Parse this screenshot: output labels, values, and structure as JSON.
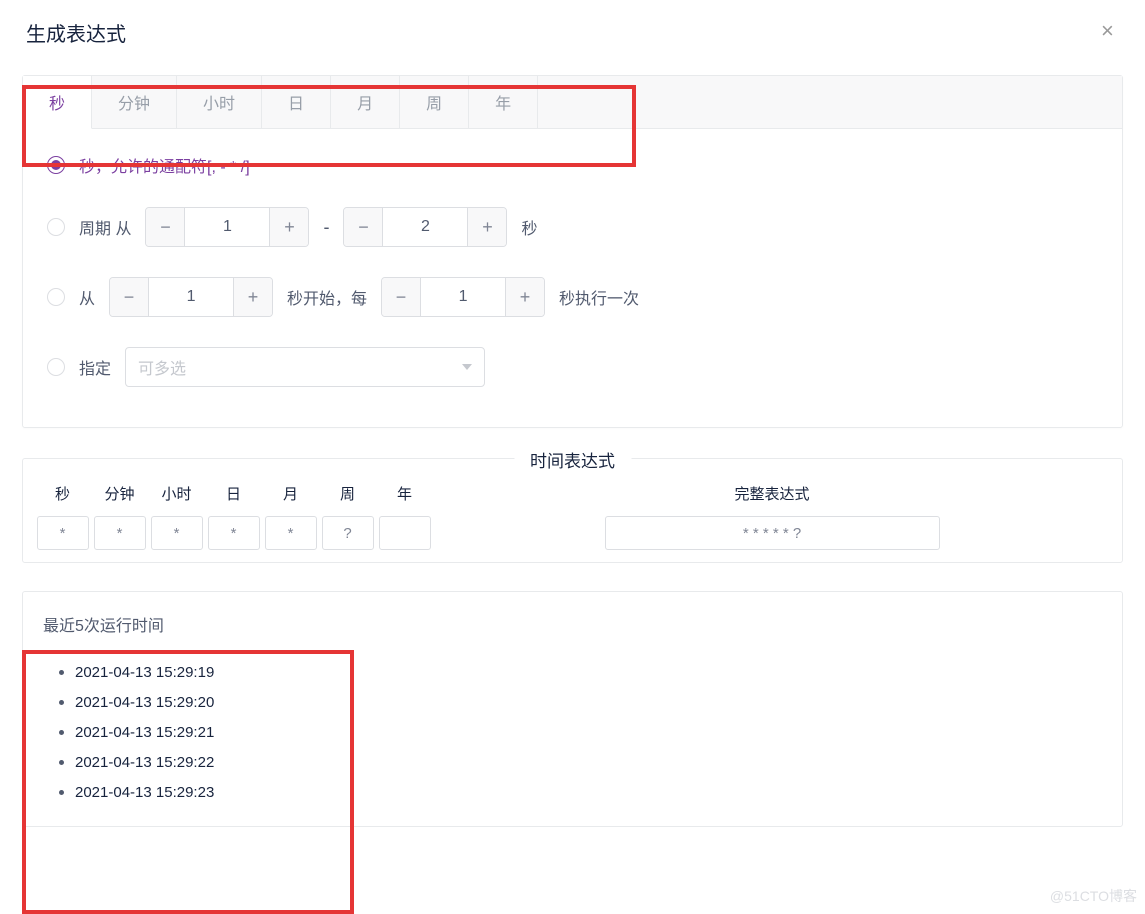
{
  "header": {
    "title": "生成表达式"
  },
  "tabs": [
    "秒",
    "分钟",
    "小时",
    "日",
    "月",
    "周",
    "年"
  ],
  "options": {
    "wildcard_label": "秒，允许的通配符[, - * /]",
    "cycle": {
      "prefix": "周期 从",
      "from": "1",
      "to": "2",
      "suffix": "秒"
    },
    "every": {
      "prefix": "从",
      "start": "1",
      "middle": "秒开始，每",
      "interval": "1",
      "suffix": "秒执行一次"
    },
    "specify": {
      "label": "指定",
      "placeholder": "可多选"
    }
  },
  "expression": {
    "legend": "时间表达式",
    "headers": [
      "秒",
      "分钟",
      "小时",
      "日",
      "月",
      "周",
      "年",
      "完整表达式"
    ],
    "values": [
      "*",
      "*",
      "*",
      "*",
      "*",
      "?",
      "",
      "* * * * * ?"
    ]
  },
  "recent": {
    "title": "最近5次运行时间",
    "items": [
      "2021-04-13 15:29:19",
      "2021-04-13 15:29:20",
      "2021-04-13 15:29:21",
      "2021-04-13 15:29:22",
      "2021-04-13 15:29:23"
    ]
  },
  "watermark": "@51CTO博客"
}
